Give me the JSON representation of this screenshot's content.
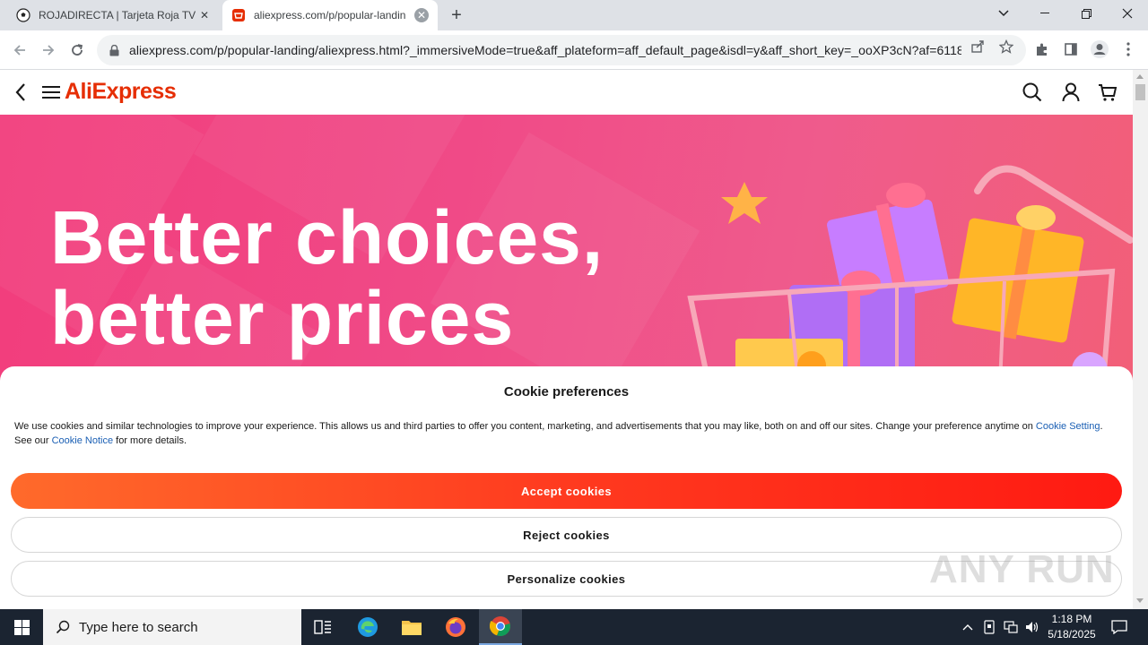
{
  "browser": {
    "tabs": [
      {
        "title": "ROJADIRECTA | Tarjeta Roja TV | F",
        "active": false
      },
      {
        "title": "aliexpress.com/p/popular-landin",
        "active": true
      }
    ],
    "url": "aliexpress.com/p/popular-landing/aliexpress.html?_immersiveMode=true&aff_plateform=aff_default_page&isdl=y&aff_short_key=_ooXP3cN?af=6118..."
  },
  "site": {
    "logo": "AliExpress"
  },
  "banner": {
    "line1": "Better choices,",
    "line2": "better prices"
  },
  "cookie": {
    "title": "Cookie preferences",
    "text_part1": "We use cookies and similar technologies to improve your experience. This allows us and third parties to offer you content, marketing, and advertisements that you may like, both on and off our sites. Change your preference anytime on ",
    "link1": "Cookie Setting",
    "text_part2": ". See our ",
    "link2": "Cookie Notice",
    "text_part3": " for more details.",
    "accept": "Accept cookies",
    "reject": "Reject cookies",
    "personalize": "Personalize cookies"
  },
  "watermark": "ANY RUN",
  "taskbar": {
    "search_placeholder": "Type here to search",
    "time": "1:18 PM",
    "date": "5/18/2025"
  },
  "colors": {
    "brand": "#e62e04",
    "banner": "#f04a87",
    "accept_start": "#ff6a2b",
    "accept_end": "#ff1a12",
    "link": "#1a5fb4"
  }
}
